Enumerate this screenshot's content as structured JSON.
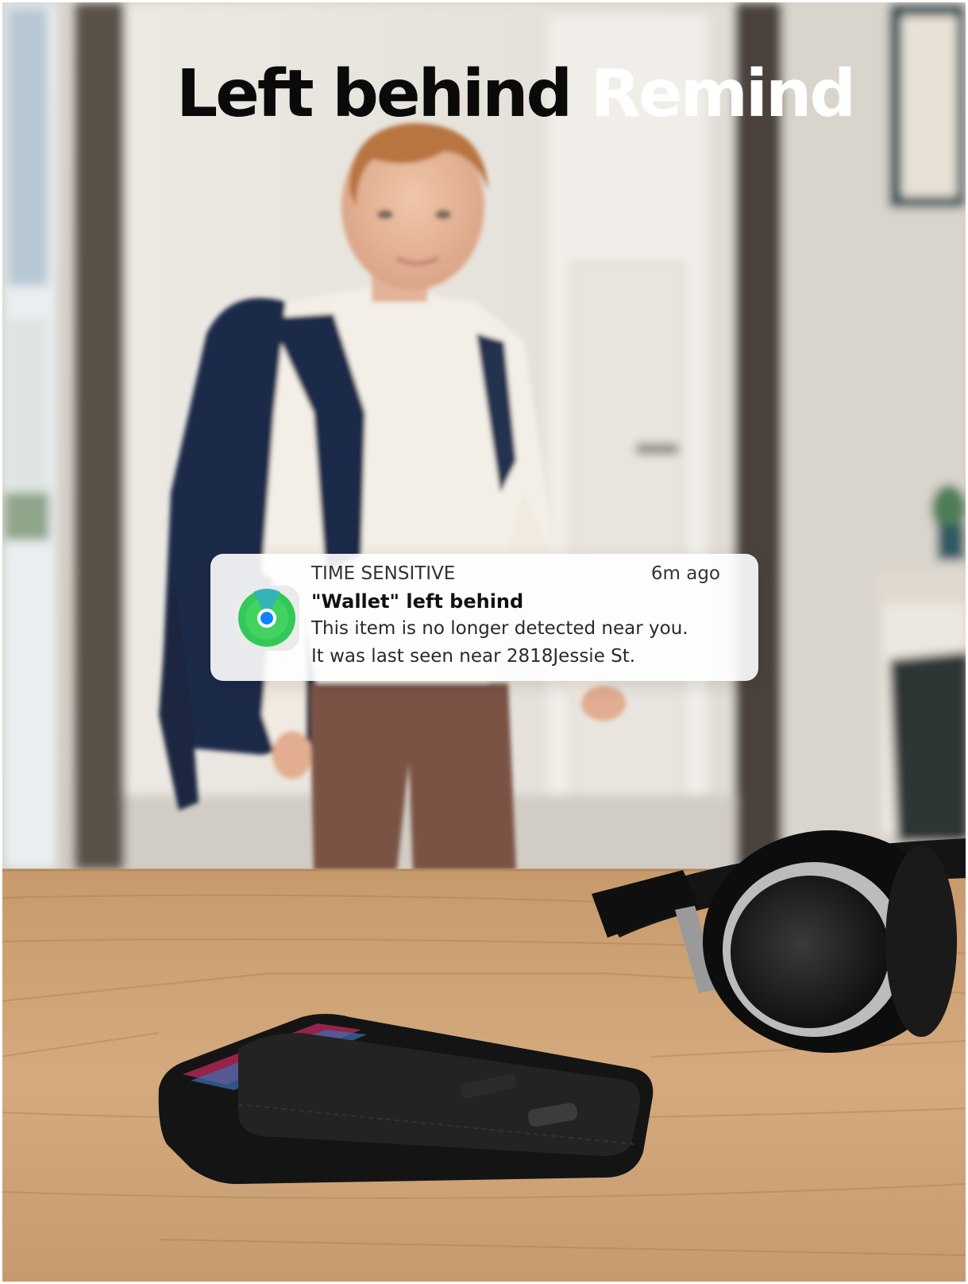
{
  "headline": {
    "part1": "Left behind",
    "part2": "Remind"
  },
  "notification": {
    "app_icon": "find-my-icon",
    "category": "TIME SENSITIVE",
    "time_ago": "6m ago",
    "title": "\"Wallet\" left behind",
    "body_line_1": "This item is no longer detected near you.",
    "body_line_2": "It was last seen near 2818Jessie St."
  },
  "colors": {
    "headline_dark": "#0a0a0a",
    "headline_light": "#ffffff",
    "find_my_green": "#34c759",
    "find_my_blue": "#0a84ff"
  }
}
